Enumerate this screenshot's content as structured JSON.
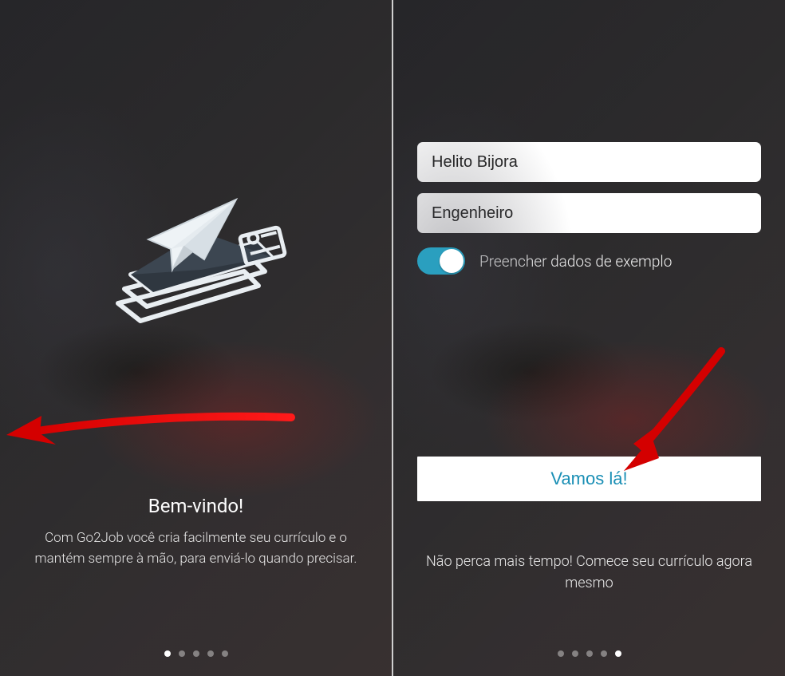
{
  "screen1": {
    "title": "Bem-vindo!",
    "subtitle": "Com Go2Job você cria facilmente seu currículo e o mantém sempre à mão, para enviá-lo quando precisar.",
    "pagination": {
      "total": 5,
      "active_index": 0
    },
    "logo_icon": "paper-plane-over-documents"
  },
  "screen2": {
    "inputs": {
      "name_value": "Helito Bijora",
      "profession_value": "Engenheiro"
    },
    "toggle": {
      "label": "Preencher dados de exemplo",
      "state": "on"
    },
    "cta_label": "Vamos lá!",
    "subtitle": "Não perca mais tempo! Comece seu currículo agora mesmo",
    "pagination": {
      "total": 5,
      "active_index": 4
    }
  },
  "colors": {
    "accent": "#2a9fbf",
    "cta_text": "#1a8fb5",
    "annotation_arrow": "#d40000"
  }
}
